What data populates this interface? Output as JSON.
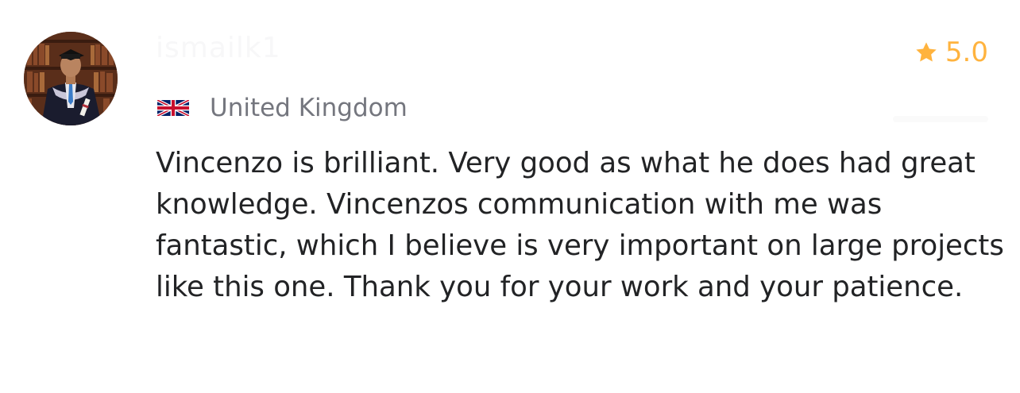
{
  "review": {
    "reviewer_name": "ismailk1",
    "rating": "5.0",
    "country": "United Kingdom",
    "text": "Vincenzo is brilliant. Very good as what he does had great knowledge. Vincenzos communication with me was fantastic, which I believe is very important on large projects like this one. Thank you for your work and your patience."
  },
  "icons": {
    "rating_icon": "star-icon",
    "country_icon": "uk-flag-icon"
  },
  "colors": {
    "rating": "#ffb33e",
    "country_text": "#74767e",
    "body_text": "#222325"
  }
}
